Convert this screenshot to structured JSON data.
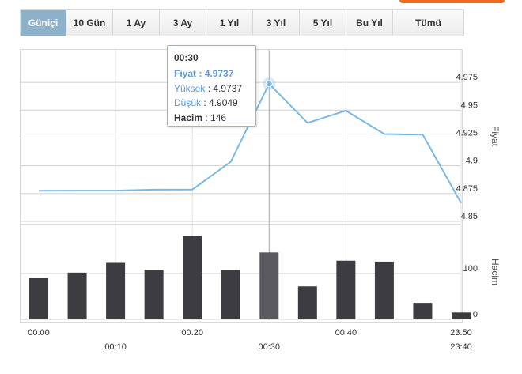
{
  "tabs": [
    {
      "label": "Güniçi",
      "active": true
    },
    {
      "label": "10 Gün",
      "active": false
    },
    {
      "label": "1 Ay",
      "active": false
    },
    {
      "label": "3 Ay",
      "active": false
    },
    {
      "label": "1 Yıl",
      "active": false
    },
    {
      "label": "3 Yıl",
      "active": false
    },
    {
      "label": "5 Yıl",
      "active": false
    },
    {
      "label": "Bu Yıl",
      "active": false
    },
    {
      "label": "Tümü",
      "active": false
    }
  ],
  "colors": {
    "accent": "#f26a21",
    "active_tab": "#8fb0c9",
    "price_line": "#7ab8e8",
    "volume_bar": "#3d3d41",
    "volume_bar_highlight": "#5a5a5e"
  },
  "tooltip": {
    "title": "00:30",
    "price_label": "Fiyat",
    "price_value": "4.9737",
    "high_label": "Yüksek",
    "high_value": "4.9737",
    "low_label": "Düşük",
    "low_value": "4.9049",
    "volume_label": "Hacim",
    "volume_value": "146"
  },
  "chart_data": [
    {
      "type": "line",
      "ylabel": "Fiyat",
      "x": [
        "00:00",
        "00:05",
        "00:10",
        "00:15",
        "00:20",
        "00:25",
        "00:30",
        "00:35",
        "00:40",
        "00:45",
        "00:50",
        "23:50"
      ],
      "series": [
        {
          "values": [
            4.8775,
            4.8776,
            4.8776,
            4.8785,
            4.8786,
            4.9035,
            4.9737,
            4.9385,
            4.9495,
            4.9285,
            4.928,
            4.8665
          ]
        }
      ],
      "yticks": [
        "4.85",
        "4.875",
        "4.9",
        "4.925",
        "4.95",
        "4.975"
      ],
      "ylim": [
        4.85,
        4.985
      ],
      "highlight_index": 6
    },
    {
      "type": "bar",
      "ylabel": "Hacim",
      "x": [
        "00:00",
        "00:05",
        "00:10",
        "00:15",
        "00:20",
        "00:25",
        "00:30",
        "00:35",
        "00:40",
        "00:45",
        "00:50",
        "23:50"
      ],
      "series": [
        {
          "values": [
            90,
            102,
            125,
            108,
            182,
            108,
            146,
            72,
            128,
            126,
            36,
            15
          ]
        }
      ],
      "yticks": [
        "0",
        "100"
      ],
      "ylim": [
        0,
        200
      ],
      "highlight_index": 6
    }
  ],
  "x_axis": {
    "top_labels": [
      "00:00",
      "00:20",
      "00:40",
      "23:50"
    ],
    "bottom_labels": [
      "00:10",
      "00:30",
      "23:40"
    ]
  }
}
